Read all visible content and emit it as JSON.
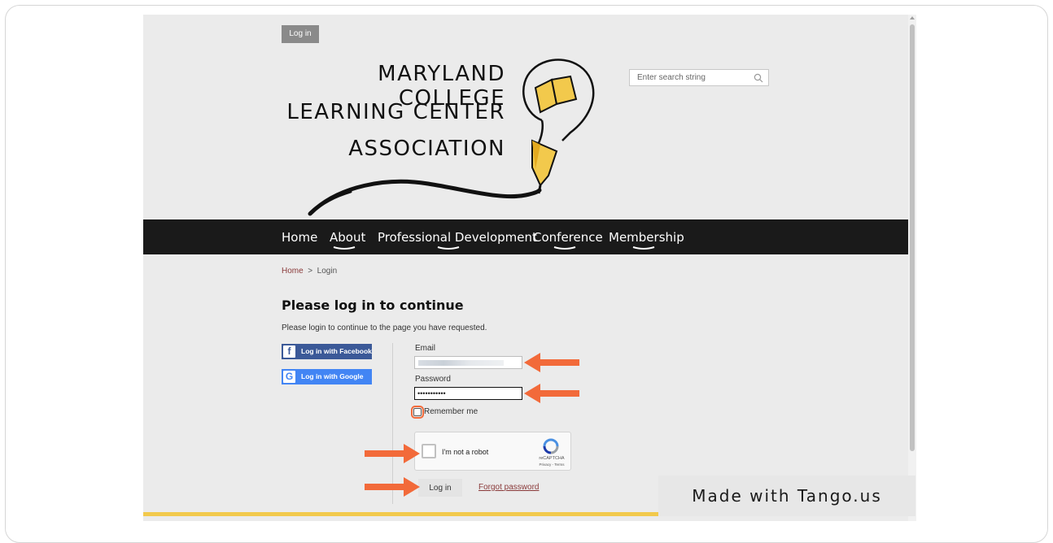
{
  "header": {
    "login_button": "Log in",
    "logo_lines": [
      "MARYLAND COLLEGE",
      "LEARNING CENTER",
      "ASSOCIATION"
    ],
    "search_placeholder": "Enter search string"
  },
  "nav": {
    "items": [
      "Home",
      "About",
      "Professional Development",
      "Conference",
      "Membership"
    ]
  },
  "breadcrumb": {
    "home": "Home",
    "separator": ">",
    "current": "Login"
  },
  "login": {
    "heading": "Please log in to continue",
    "subtext": "Please login to continue to the page you have requested.",
    "facebook_button": "Log in with Facebook",
    "google_button": "Log in with Google",
    "email_label": "Email",
    "password_label": "Password",
    "password_value": "•••••••••••",
    "remember_label": "Remember me",
    "captcha_label": "I'm not a robot",
    "captcha_brand": "reCAPTCHA",
    "captcha_links": "Privacy - Terms",
    "submit_button": "Log in",
    "forgot_link": "Forgot password"
  },
  "watermark": "Made with Tango.us",
  "colors": {
    "nav_bg": "#1a1a1a",
    "facebook": "#3b5998",
    "google": "#4285f4",
    "arrow": "#f26a3a",
    "link": "#8a3a3a",
    "accent_strip": "#f2c94c"
  }
}
